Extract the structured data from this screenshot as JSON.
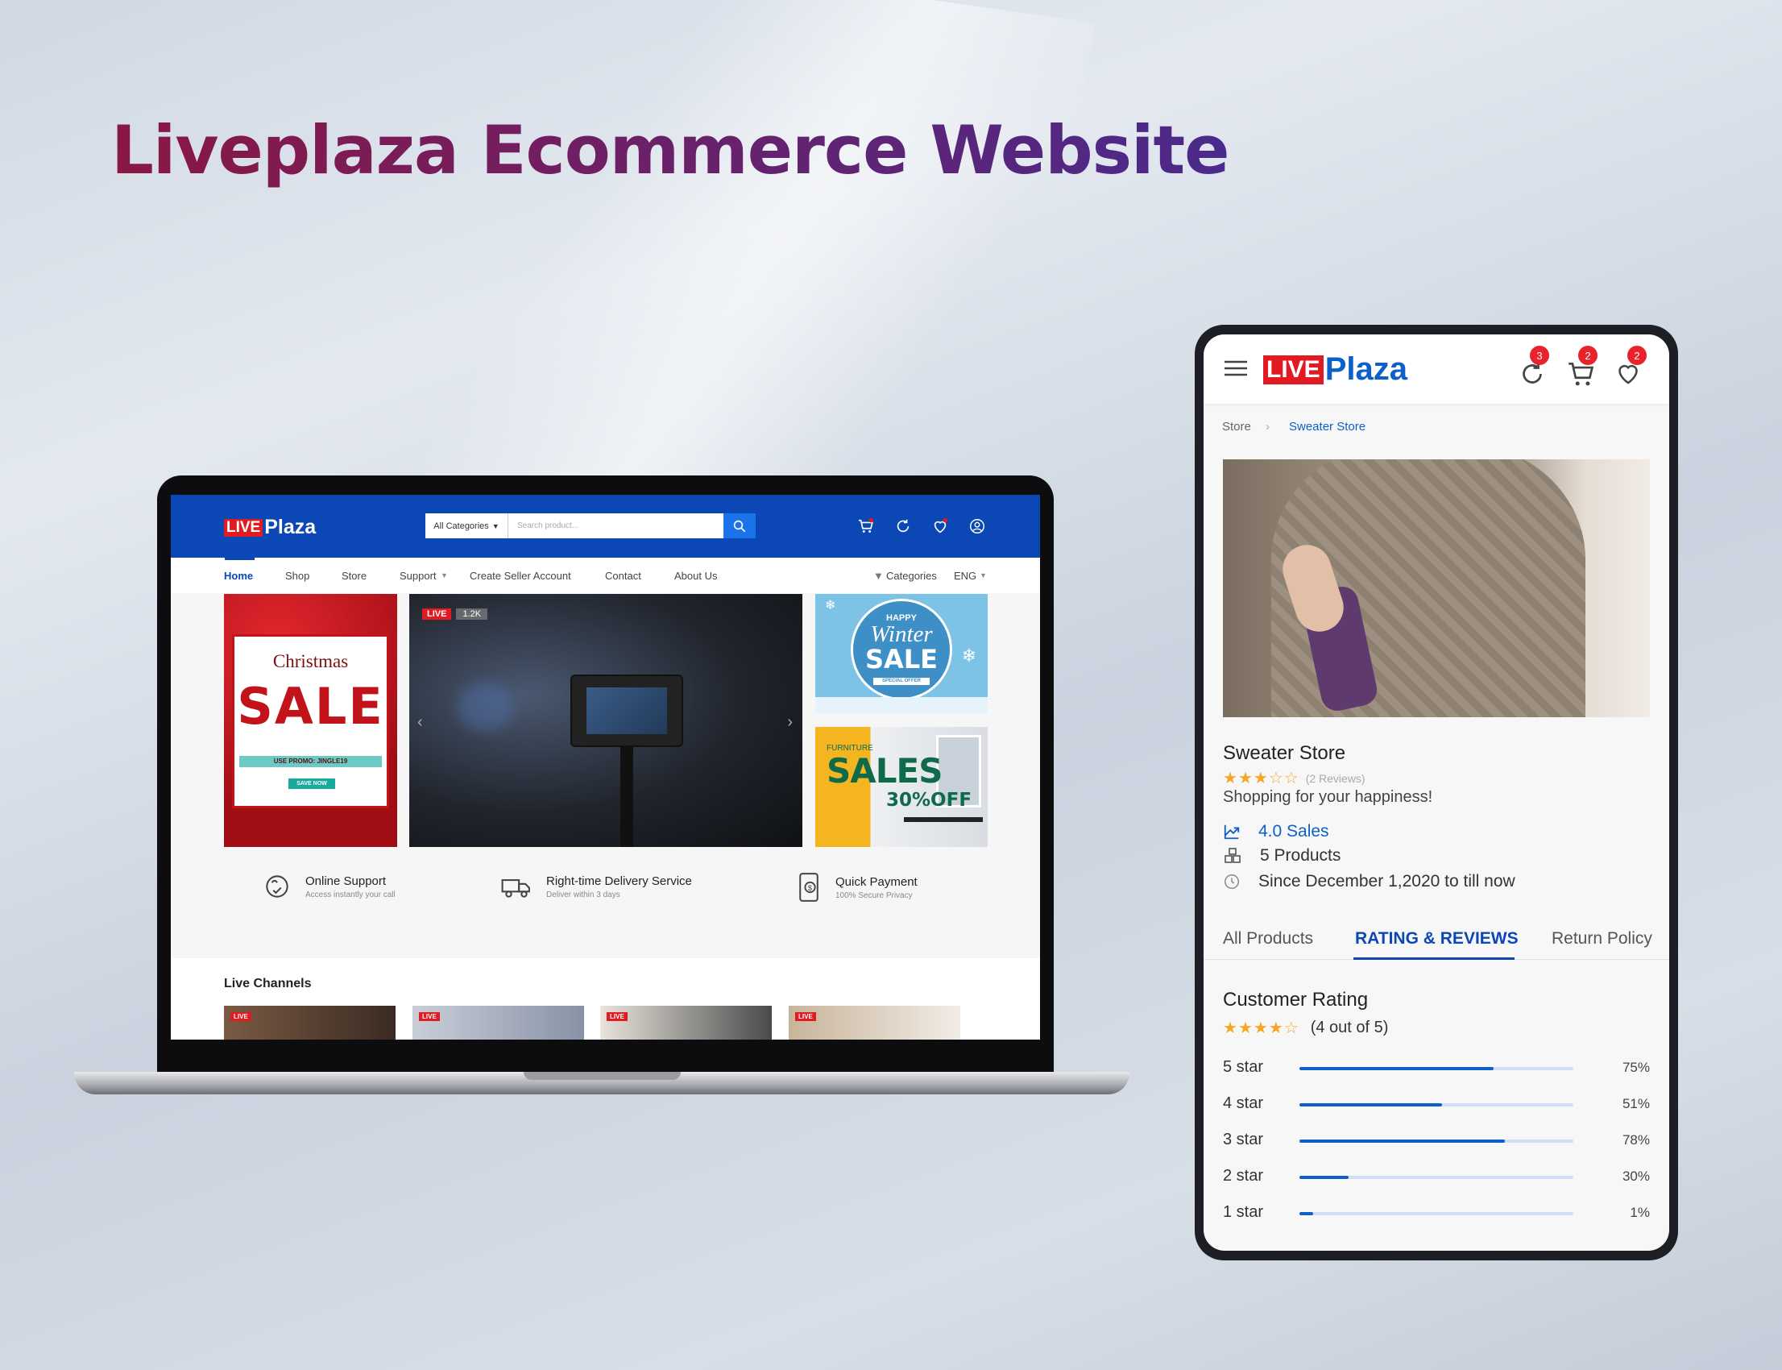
{
  "page": {
    "title": "Liveplaza Ecommerce Website"
  },
  "desktop": {
    "logo": {
      "live": "LIVE",
      "plaza": "Plaza"
    },
    "search": {
      "category": "All Categories",
      "placeholder": "Search product..."
    },
    "nav": {
      "items": [
        "Home",
        "Shop",
        "Store",
        "Support",
        "Create Seller Account",
        "Contact",
        "About Us"
      ],
      "active": "Home",
      "categories": "Categories",
      "language": "ENG"
    },
    "banners": {
      "christmas": {
        "line1": "Christmas",
        "line2": "SALE",
        "promo": "USE PROMO: JINGLE19",
        "cta": "SAVE NOW"
      },
      "live": {
        "badge": "LIVE",
        "viewers": "1.2K"
      },
      "winter": {
        "happy": "HAPPY",
        "winter": "Winter",
        "sale": "SALE",
        "tag": "SPECIAL OFFER"
      },
      "furniture": {
        "label": "FURNITURE",
        "sales": "SALES",
        "off": "30%OFF"
      }
    },
    "features": [
      {
        "title": "Online Support",
        "sub": "Access instantly your call",
        "icon": "support-icon"
      },
      {
        "title": "Right-time Delivery Service",
        "sub": "Deliver within 3 days",
        "icon": "truck-icon"
      },
      {
        "title": "Quick Payment",
        "sub": "100% Secure Privacy",
        "icon": "payment-icon"
      }
    ],
    "live_channels": {
      "title": "Live Channels",
      "badge": "LIVE"
    },
    "colors": {
      "brand": "#0b47b5",
      "live_red": "#e21b23"
    }
  },
  "mobile": {
    "logo": {
      "live": "LIVE",
      "plaza": "Plaza"
    },
    "badges": {
      "refresh": "3",
      "cart": "2",
      "wishlist": "2"
    },
    "breadcrumb": {
      "root": "Store",
      "current": "Sweater Store"
    },
    "store": {
      "name": "Sweater Store",
      "reviews": "(2 Reviews)",
      "rating_stars": 3,
      "tagline": "Shopping for your happiness!",
      "sales": "4.0 Sales",
      "products": "5 Products",
      "since": "Since December 1,2020 to till now"
    },
    "tabs": [
      "All Products",
      "RATING & REVIEWS",
      "Return Policy"
    ],
    "active_tab": "RATING & REVIEWS",
    "customer_rating": {
      "title": "Customer Rating",
      "summary": "(4 out of 5)",
      "stars": 4,
      "rows": [
        {
          "label": "5 star",
          "percent": "75%",
          "value": 0.71
        },
        {
          "label": "4 star",
          "percent": "51%",
          "value": 0.52
        },
        {
          "label": "3 star",
          "percent": "78%",
          "value": 0.75
        },
        {
          "label": "2 star",
          "percent": "30%",
          "value": 0.18
        },
        {
          "label": "1 star",
          "percent": "1%",
          "value": 0.05
        }
      ]
    }
  }
}
